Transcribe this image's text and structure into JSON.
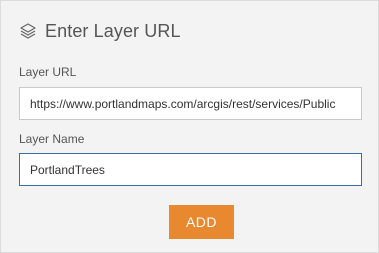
{
  "dialog": {
    "title": "Enter Layer URL",
    "icon": "layers-icon"
  },
  "layer_url": {
    "label": "Layer URL",
    "value": "https://www.portlandmaps.com/arcgis/rest/services/Public"
  },
  "layer_name": {
    "label": "Layer Name",
    "value": "PortlandTrees"
  },
  "add_button": {
    "label": "ADD",
    "color": "#e8892f"
  }
}
